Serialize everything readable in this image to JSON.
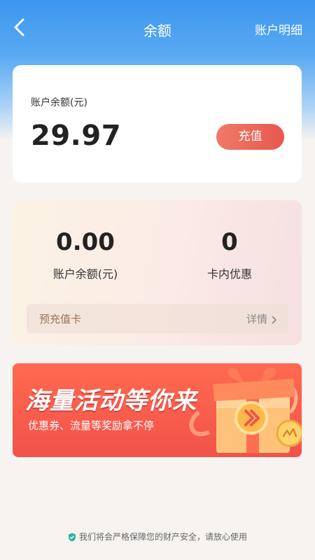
{
  "header": {
    "title": "余额",
    "detail_link": "账户明细"
  },
  "balance_card": {
    "label": "账户余额(元)",
    "value": "29.97",
    "recharge_label": "充值"
  },
  "card_section": {
    "stats": [
      {
        "value": "0.00",
        "label": "账户余额(元)"
      },
      {
        "value": "0",
        "label": "卡内优惠"
      }
    ],
    "prepaid_label": "预充值卡",
    "detail_label": "详情"
  },
  "banner": {
    "title": "海量活动等你来",
    "subtitle": "优惠券、流量等奖励拿不停"
  },
  "footer": {
    "notice": "我们将会严格保障您的财产安全，请放心使用"
  },
  "colors": {
    "primary_blue": "#3b97ef",
    "recharge_red": "#e8574f",
    "banner_red": "#f2524a",
    "footer_shield": "#2bb3a0"
  }
}
